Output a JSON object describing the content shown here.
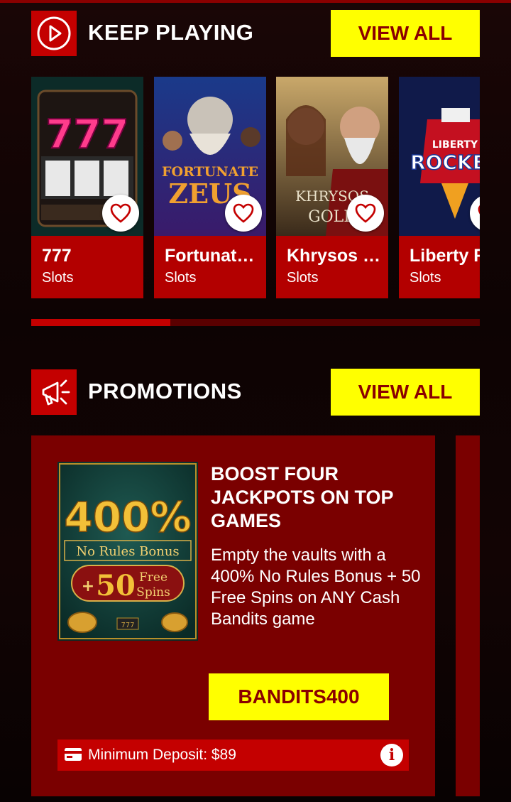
{
  "sections": {
    "keep_playing": {
      "title": "KEEP PLAYING",
      "view_all": "VIEW ALL"
    },
    "promotions": {
      "title": "PROMOTIONS",
      "view_all": "VIEW ALL"
    }
  },
  "games": [
    {
      "title": "777",
      "category": "Slots",
      "art_text": "777"
    },
    {
      "title": "Fortunat…",
      "category": "Slots",
      "art_text_1": "FORTUNATE",
      "art_text_2": "ZEUS"
    },
    {
      "title": "Khrysos …",
      "category": "Slots",
      "art_text_1": "KHRYSOS",
      "art_text_2": "GOLD"
    },
    {
      "title": "Liberty R",
      "category": "Slots",
      "art_text_1": "LIBERTY",
      "art_text_2": "ROCKET"
    }
  ],
  "scroll": {
    "progress": 0.31
  },
  "promo": {
    "image": {
      "percent": "400%",
      "line1": "No Rules Bonus",
      "plus": "+",
      "spins_num": "50",
      "spins_1": "Free",
      "spins_2": "Spins",
      "mini": "777"
    },
    "title": "BOOST FOUR JACKPOTS ON TOP GAMES",
    "description": "Empty the vaults with a 400% No Rules Bonus + 50 Free Spins on ANY Cash Bandits game",
    "code": "BANDITS400",
    "min_deposit": "Minimum Deposit: $89",
    "info_symbol": "i"
  },
  "colors": {
    "accent_red": "#c40000",
    "dark_red": "#7a0000",
    "yellow": "#ffff00",
    "text_maroon": "#8a0000"
  },
  "icons": [
    "play-circle-icon",
    "megaphone-icon",
    "heart-icon",
    "credit-card-icon",
    "info-icon"
  ]
}
